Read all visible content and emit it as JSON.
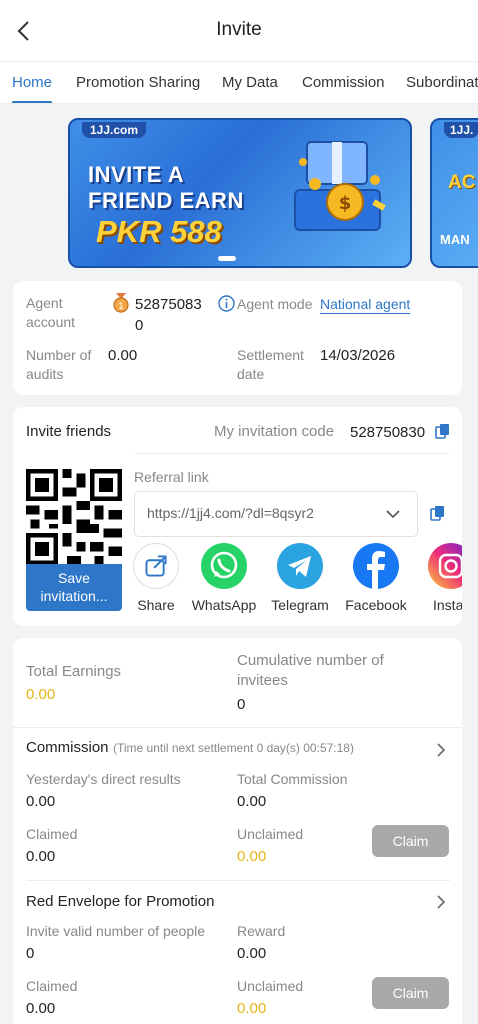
{
  "header": {
    "title": "Invite"
  },
  "tabs": [
    {
      "label": "Home"
    },
    {
      "label": "Promotion Sharing"
    },
    {
      "label": "My Data"
    },
    {
      "label": "Commission"
    },
    {
      "label": "Subordinat"
    }
  ],
  "banner": {
    "logo": "1JJ.com",
    "line1": "INVITE A",
    "line2": "FRIEND EARN",
    "amount": "PKR 588",
    "next_logo": "1JJ.",
    "next_line1": "AC",
    "next_line2": "MAN"
  },
  "account": {
    "agent_account_label": "Agent account",
    "agent_account_value": "52875083 0",
    "agent_mode_label": "Agent mode",
    "agent_mode_value": "National agent",
    "audits_label": "Number of audits",
    "audits_value": "0.00",
    "settlement_label": "Settlement date",
    "settlement_value": "14/03/2026"
  },
  "invite": {
    "title": "Invite friends",
    "code_label": "My invitation code",
    "code_value": "528750830",
    "referral_label": "Referral link",
    "referral_value": "https://1jj4.com/?dl=8qsyr2",
    "save_label": "Save invitation...",
    "share": [
      {
        "label": "Share",
        "icon": "share-icon"
      },
      {
        "label": "WhatsApp",
        "icon": "whatsapp-icon",
        "color": "#25d366"
      },
      {
        "label": "Telegram",
        "icon": "telegram-icon",
        "color": "#2aa3e0"
      },
      {
        "label": "Facebook",
        "icon": "facebook-icon",
        "color": "#1877f2"
      },
      {
        "label": "Insta",
        "icon": "instagram-icon"
      }
    ]
  },
  "earnings": {
    "total_label": "Total Earnings",
    "total_value": "0.00",
    "invitees_label": "Cumulative number of invitees",
    "invitees_value": "0"
  },
  "commission": {
    "title": "Commission",
    "timer": "(Time until next settlement  0 day(s) 00:57:18)",
    "yesterday_label": "Yesterday's direct results",
    "yesterday_value": "0.00",
    "total_label": "Total Commission",
    "total_value": "0.00",
    "claimed_label": "Claimed",
    "claimed_value": "0.00",
    "unclaimed_label": "Unclaimed",
    "unclaimed_value": "0.00",
    "claim_button": "Claim"
  },
  "red_envelope": {
    "title": "Red Envelope for Promotion",
    "valid_label": "Invite valid number of people",
    "valid_value": "0",
    "reward_label": "Reward",
    "reward_value": "0.00",
    "claimed_label": "Claimed",
    "claimed_value": "0.00",
    "unclaimed_label": "Unclaimed",
    "unclaimed_value": "0.00",
    "claim_button": "Claim"
  },
  "colors": {
    "accent": "#2d76c8",
    "gold": "#e6b514",
    "disabled": "#a9a9a9"
  }
}
